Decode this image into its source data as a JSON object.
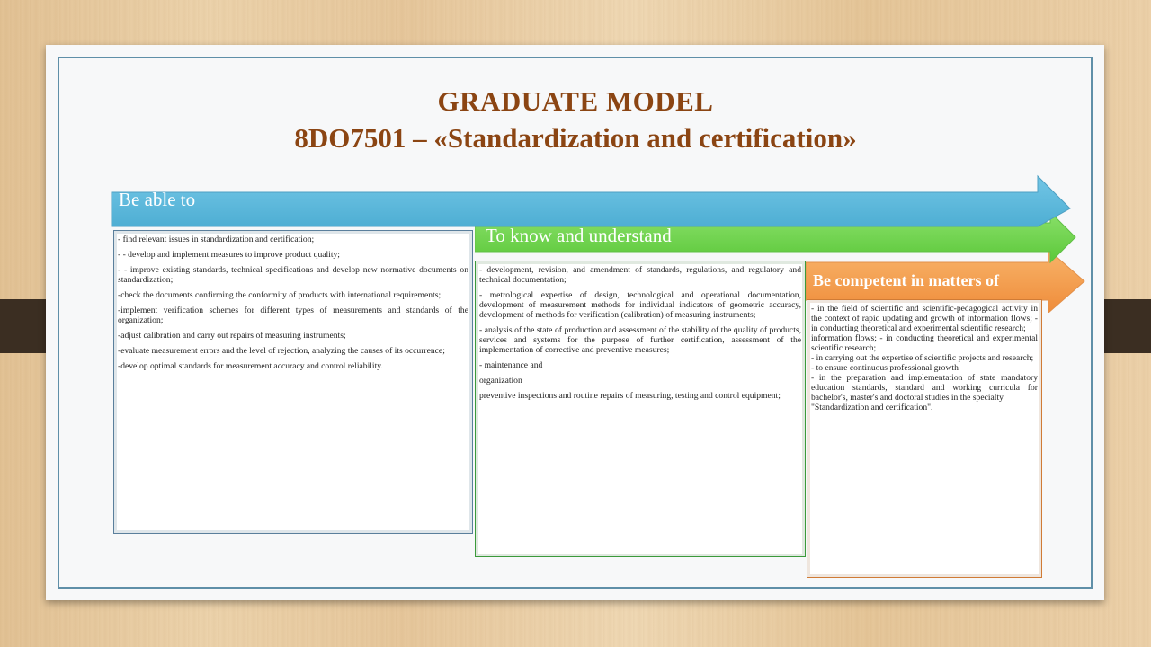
{
  "title": {
    "line1": "GRADUATE MODEL",
    "line2": "8DO7501 – «Standardization and certification»"
  },
  "colors": {
    "title": "#8b4513",
    "blue_arrow": "#5bb8d9",
    "green_arrow": "#6fd64a",
    "orange_arrow": "#f5a04e"
  },
  "columns": [
    {
      "heading": "Be able to",
      "items": [
        "- find relevant issues in standardization and certification;",
        "- - develop and implement measures to improve product quality;",
        "- - improve existing standards, technical specifications and develop new normative documents on standardization;",
        "-check the documents confirming the conformity of products with international requirements;",
        "-implement verification schemes for different types of measurements and standards of the organization;",
        "-adjust calibration and carry out repairs of measuring instruments;",
        "-evaluate measurement errors and the level of rejection, analyzing the causes of its occurrence;",
        "-develop optimal standards for measurement accuracy and control reliability."
      ]
    },
    {
      "heading": "To know and understand",
      "items": [
        "- development, revision, and amendment of standards, regulations, and regulatory and technical documentation;",
        "- metrological expertise of design, technological and operational documentation, development of measurement methods for individual indicators of geometric accuracy, development of methods for verification (calibration) of measuring instruments;",
        "- analysis of the state of production and assessment of the stability of the quality of products, services and systems for the purpose of further certification, assessment of the implementation of corrective and preventive measures;",
        "- maintenance and",
        "organization",
        "preventive inspections and routine repairs of measuring, testing and control equipment;"
      ]
    },
    {
      "heading": "Be competent in matters of",
      "items": [
        "- in the field of scientific and scientific-pedagogical activity in the context of rapid updating and growth of information flows; - in conducting theoretical and experimental scientific research;",
        "information flows; - in conducting theoretical and experimental scientific research;",
        "- in carrying out the expertise of scientific projects and research;",
        "- to ensure continuous professional growth",
        "- in the preparation and implementation of state mandatory education standards, standard and working curricula for bachelor's, master's and doctoral studies in the specialty",
        "\"Standardization and certification\"."
      ]
    }
  ]
}
